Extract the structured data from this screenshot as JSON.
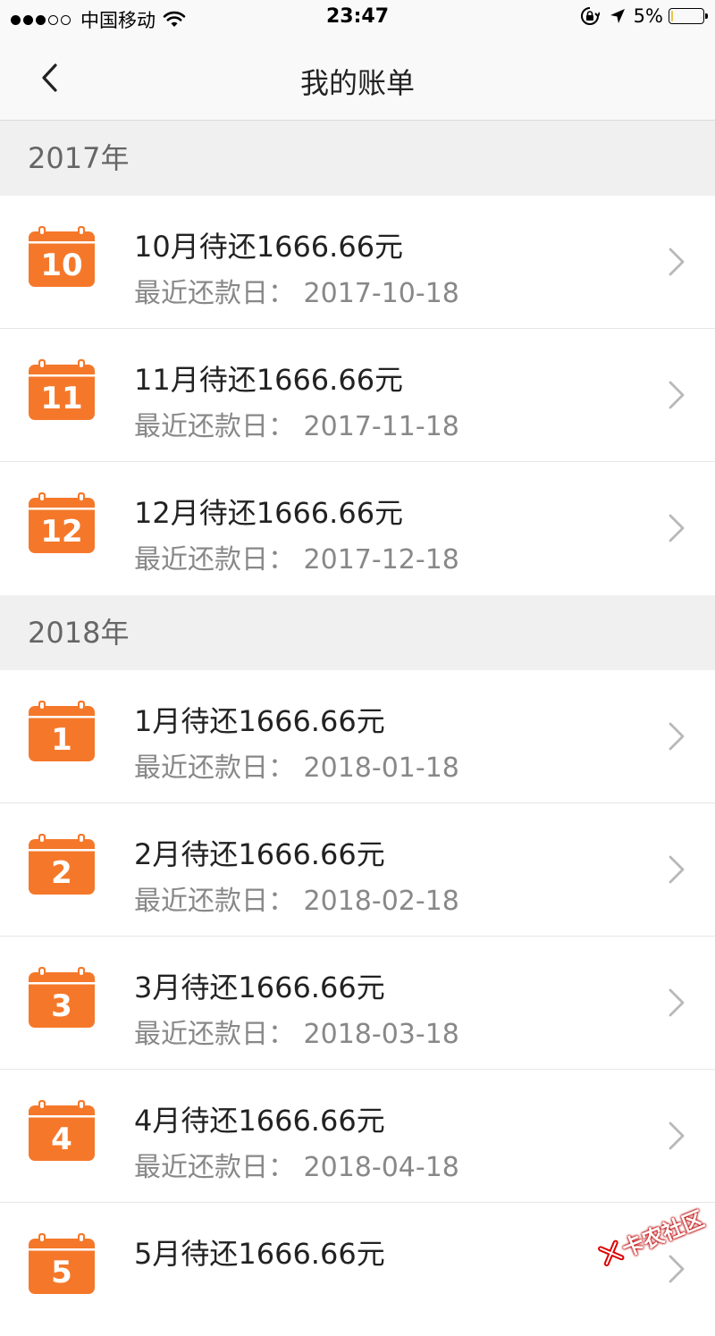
{
  "status_bar": {
    "signal_full": 3,
    "signal_empty": 2,
    "carrier": "中国移动",
    "time": "23:47",
    "battery": "5%",
    "battery_level_percent": 5,
    "icons": [
      "wifi-icon",
      "lock-rotation-icon",
      "location-icon",
      "battery-icon"
    ]
  },
  "nav": {
    "title": "我的账单",
    "back_icon": "chevron-left-icon"
  },
  "colors": {
    "accent": "#f5782a",
    "section_bg": "#f0f0f0",
    "title_text": "#222222",
    "secondary_text": "#888888"
  },
  "sections": [
    {
      "year": "2017年",
      "items": [
        {
          "num": "10",
          "title": "10月待还1666.66元",
          "date": "最近还款日：  2017-10-18"
        },
        {
          "num": "11",
          "title": "11月待还1666.66元",
          "date": "最近还款日：  2017-11-18"
        },
        {
          "num": "12",
          "title": "12月待还1666.66元",
          "date": "最近还款日：  2017-12-18"
        }
      ]
    },
    {
      "year": "2018年",
      "items": [
        {
          "num": "1",
          "title": "1月待还1666.66元",
          "date": "最近还款日：  2018-01-18"
        },
        {
          "num": "2",
          "title": "2月待还1666.66元",
          "date": "最近还款日：  2018-02-18"
        },
        {
          "num": "3",
          "title": "3月待还1666.66元",
          "date": "最近还款日：  2018-03-18"
        },
        {
          "num": "4",
          "title": "4月待还1666.66元",
          "date": "最近还款日：  2018-04-18"
        },
        {
          "num": "5",
          "title": "5月待还1666.66元",
          "date": ""
        }
      ]
    }
  ],
  "watermark": "卡农社区"
}
